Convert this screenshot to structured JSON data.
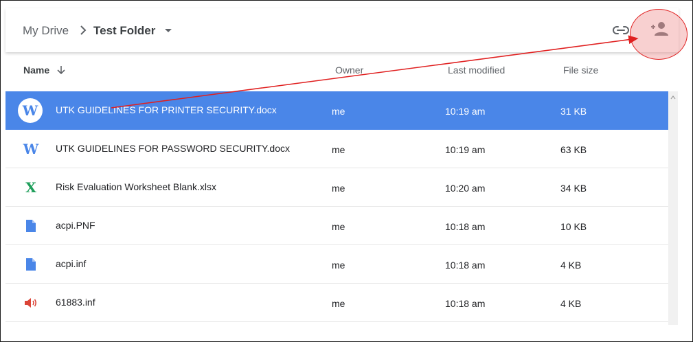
{
  "breadcrumb": {
    "root": "My Drive",
    "current": "Test Folder"
  },
  "toolbar": {
    "link_icon": "link-icon",
    "share_icon": "person-add-icon"
  },
  "columns": {
    "name": "Name",
    "owner": "Owner",
    "modified": "Last modified",
    "size": "File size"
  },
  "files": [
    {
      "name": "UTK GUIDELINES FOR PRINTER SECURITY.docx",
      "owner": "me",
      "modified": "10:19 am",
      "size": "31 KB",
      "icon": "word-icon",
      "selected": true
    },
    {
      "name": "UTK GUIDELINES FOR PASSWORD SECURITY.docx",
      "owner": "me",
      "modified": "10:19 am",
      "size": "63 KB",
      "icon": "word-icon",
      "selected": false
    },
    {
      "name": "Risk Evaluation Worksheet Blank.xlsx",
      "owner": "me",
      "modified": "10:20 am",
      "size": "34 KB",
      "icon": "excel-icon",
      "selected": false
    },
    {
      "name": "acpi.PNF",
      "owner": "me",
      "modified": "10:18 am",
      "size": "10 KB",
      "icon": "document-icon",
      "selected": false
    },
    {
      "name": "acpi.inf",
      "owner": "me",
      "modified": "10:18 am",
      "size": "4 KB",
      "icon": "document-icon",
      "selected": false
    },
    {
      "name": "61883.inf",
      "owner": "me",
      "modified": "10:18 am",
      "size": "4 KB",
      "icon": "audio-icon",
      "selected": false
    }
  ],
  "colors": {
    "selected_row": "#4a86e8",
    "word": "#4a86e8",
    "excel": "#1e9e5a",
    "document": "#4a86e8",
    "audio": "#db4437",
    "annotation": "#e02020"
  }
}
